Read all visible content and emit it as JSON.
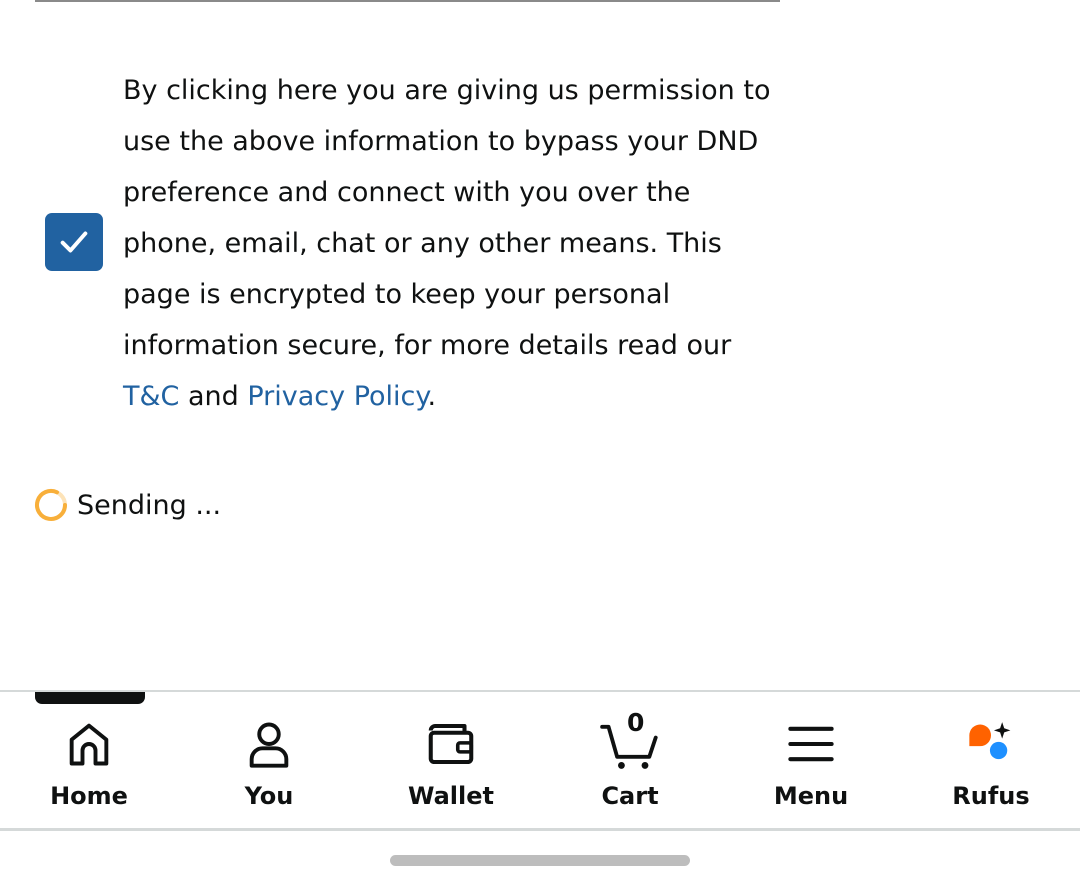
{
  "consent": {
    "checked": true,
    "text_before": "By clicking here you are giving us permission to use the above information to bypass your DND preference and connect with you over the phone, email, chat or any other means. This page is encrypted to keep your personal information secure, for more details read our ",
    "tc_link": "T&C",
    "and_text": " and ",
    "privacy_link": "Privacy Policy",
    "period": "."
  },
  "status": {
    "sending_text": "Sending ..."
  },
  "nav": {
    "home": "Home",
    "you": "You",
    "wallet": "Wallet",
    "cart": "Cart",
    "cart_count": "0",
    "menu": "Menu",
    "rufus": "Rufus"
  },
  "colors": {
    "accent_blue": "#2162a1",
    "text": "#0f1111",
    "spinner": "#f7a623",
    "rufus_orange": "#ff6200",
    "rufus_blue": "#1e90ff"
  },
  "icons": [
    "check-icon",
    "spinner-icon",
    "home-icon",
    "user-icon",
    "wallet-icon",
    "cart-icon",
    "menu-icon",
    "rufus-icon"
  ]
}
